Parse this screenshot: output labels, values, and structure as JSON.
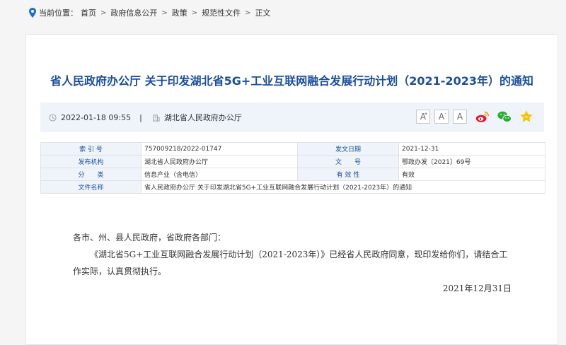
{
  "breadcrumb": {
    "lead": "当前位置：",
    "items": [
      "首页",
      "政府信息公开",
      "政策",
      "规范性文件",
      "正文"
    ]
  },
  "article": {
    "title": "省人民政府办公厅 关于印发湖北省5G+工业互联网融合发展行动计划（2021-2023年）的通知",
    "datetime": "2022-01-18 09:55",
    "separator": "|",
    "publisher": "湖北省人民政府办公厅"
  },
  "font_buttons": [
    "A",
    "A",
    "A"
  ],
  "share": [
    "weibo-icon",
    "wechat-icon",
    "favorite-star-icon"
  ],
  "info_table": {
    "rows": [
      {
        "l1": "索 引 号",
        "v1": "757009218/2022-01747",
        "l2": "发文日期",
        "v2": "2021-12-31"
      },
      {
        "l1": "发布机构",
        "v1": "湖北省人民政府办公厅",
        "l2": "文　　号",
        "v2": "鄂政办发〔2021〕69号"
      },
      {
        "l1": "分　　类",
        "v1": "信息产业（含电信）",
        "l2": "有 效 性",
        "v2": "有效"
      }
    ],
    "name_label": "文件名称",
    "name_value": "省人民政府办公厅 关于印发湖北省5G+工业互联网融合发展行动计划（2021-2023年）的通知"
  },
  "body": {
    "greeting": "各市、州、县人民政府，省政府各部门：",
    "paragraph": "《湖北省5G+工业互联网融合发展行动计划（2021-2023年）》已经省人民政府同意，现印发给你们，请结合工作实际，认真贯彻执行。",
    "date": "2021年12月31日"
  },
  "colors": {
    "accent": "#1b4e9b",
    "meta_bg": "#eef4fa",
    "location_icon": "#1b6fd1"
  }
}
